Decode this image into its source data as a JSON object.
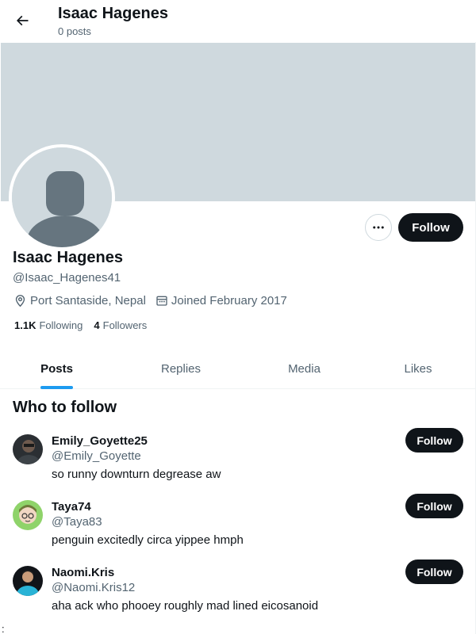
{
  "header": {
    "title": "Isaac Hagenes",
    "post_count": "0 posts"
  },
  "profile": {
    "name": "Isaac Hagenes",
    "handle": "@Isaac_Hagenes41",
    "location": "Port Santaside, Nepal",
    "joined": "Joined February 2017",
    "following_count": "1.1K",
    "following_label": "Following",
    "followers_count": "4",
    "followers_label": "Followers",
    "follow_label": "Follow"
  },
  "tabs": [
    {
      "label": "Posts",
      "active": true
    },
    {
      "label": "Replies",
      "active": false
    },
    {
      "label": "Media",
      "active": false
    },
    {
      "label": "Likes",
      "active": false
    }
  ],
  "who_to_follow": {
    "title": "Who to follow",
    "users": [
      {
        "name": "Emily_Goyette25",
        "handle": "@Emily_Goyette",
        "bio": "so runny downturn degrease aw",
        "follow_label": "Follow"
      },
      {
        "name": "Taya74",
        "handle": "@Taya83",
        "bio": "penguin excitedly circa yippee hmph",
        "follow_label": "Follow"
      },
      {
        "name": "Naomi.Kris",
        "handle": "@Naomi.Kris12",
        "bio": "aha ack who phooey roughly mad lined eicosanoid",
        "follow_label": "Follow"
      }
    ]
  },
  "footer_glyph": ":",
  "colors": {
    "accent": "#1d9bf0",
    "banner": "#cfd9de",
    "text_primary": "#0f1419",
    "text_secondary": "#536471"
  }
}
